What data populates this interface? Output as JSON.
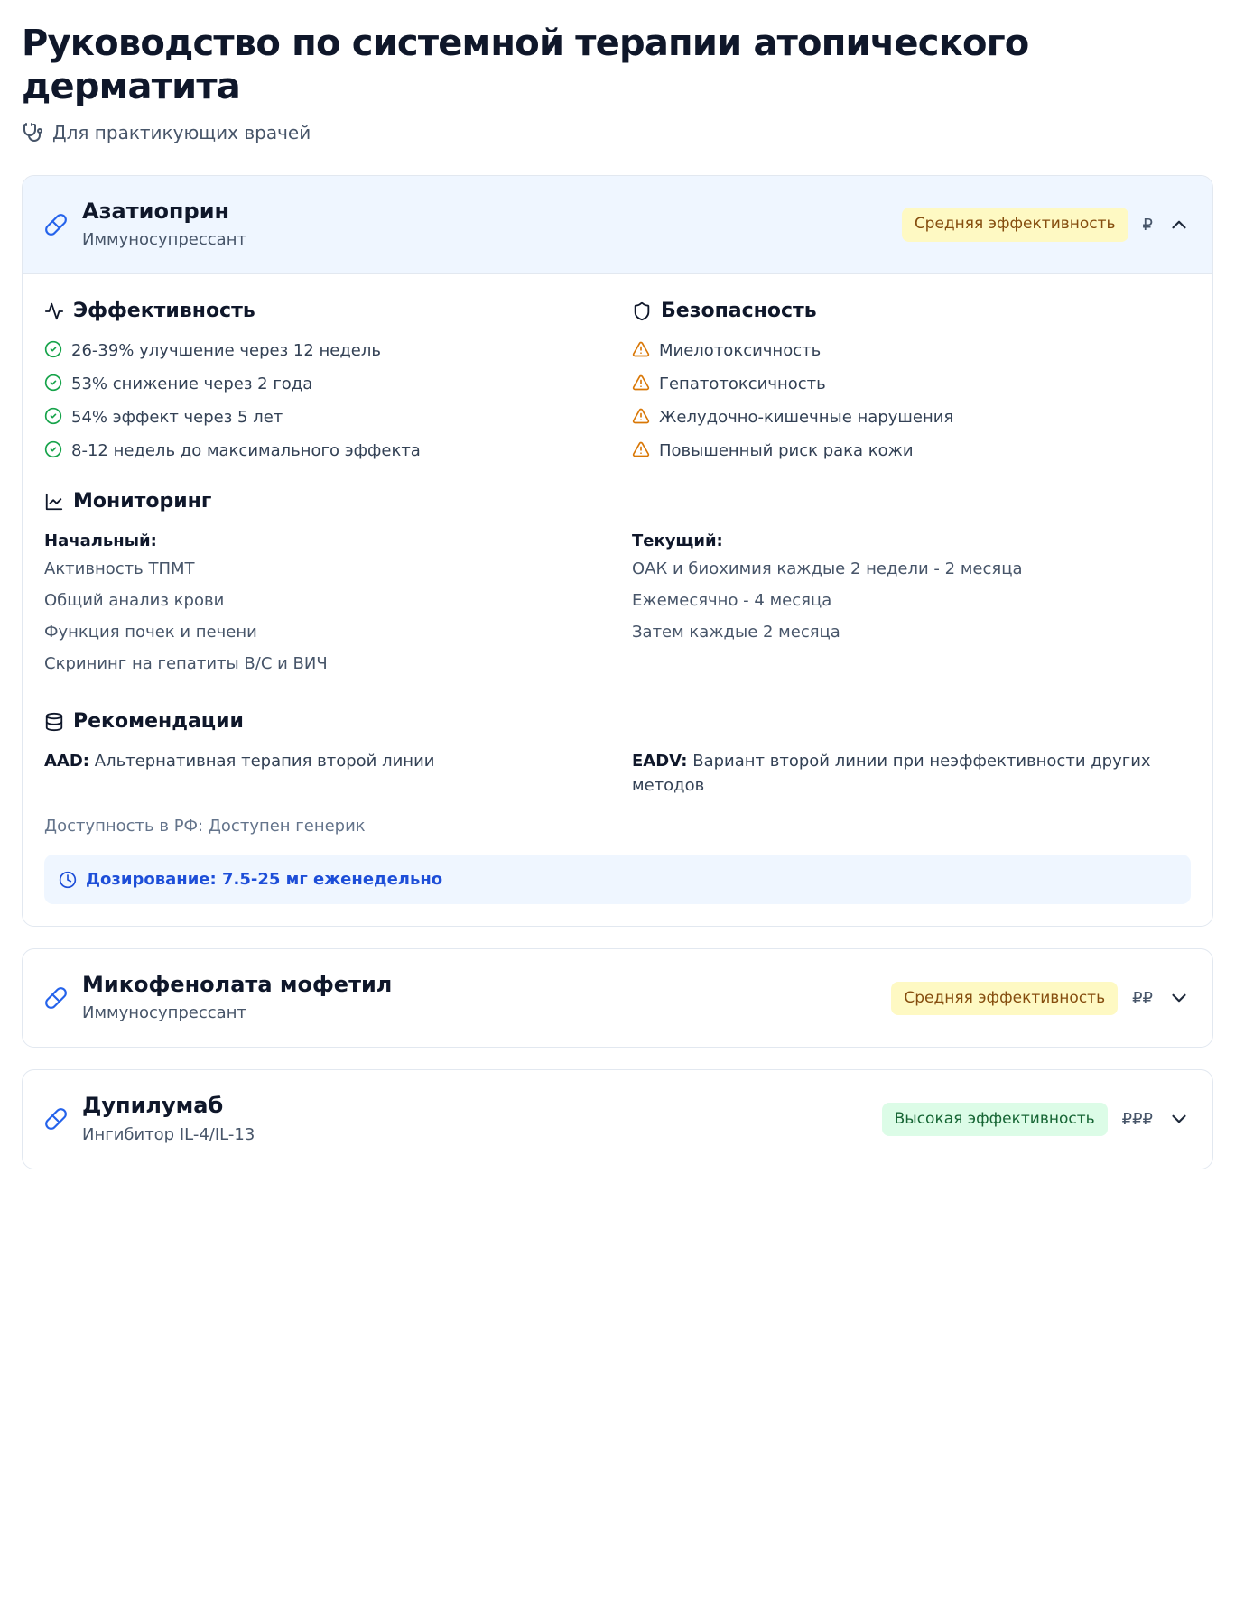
{
  "page": {
    "title": "Руководство по системной терапии атопического дерматита",
    "subtitle": "Для практикующих врачей"
  },
  "labels": {
    "efficacy_h": "Эффективность",
    "safety_h": "Безопасность",
    "monitoring_h": "Мониторинг",
    "recommendations_h": "Рекомендации",
    "mon_initial": "Начальный:",
    "mon_ongoing": "Текущий:",
    "aad": "AAD:",
    "eadv": "EADV:",
    "avail_prefix": "Доступность в РФ:",
    "dosing_prefix": "Дозирование:"
  },
  "drugs": [
    {
      "name": "Азатиоприн",
      "class": "Иммуносупрессант",
      "efficacy_level": "medium",
      "efficacy_badge": "Средняя эффективность",
      "cost_filled": "₽",
      "cost_dim": "",
      "expanded": true,
      "efficacy": [
        "26-39% улучшение через 12 недель",
        "53% снижение через 2 года",
        "54% эффект через 5 лет",
        "8-12 недель до максимального эффекта"
      ],
      "safety": [
        "Миелотоксичность",
        "Гепатотоксичность",
        "Желудочно-кишечные нарушения",
        "Повышенный риск рака кожи"
      ],
      "monitoring": {
        "initial": [
          "Активность ТПМТ",
          "Общий анализ крови",
          "Функция почек и печени",
          "Скрининг на гепатиты B/C и ВИЧ"
        ],
        "ongoing": [
          "ОАК и биохимия каждые 2 недели - 2 месяца",
          "Ежемесячно - 4 месяца",
          "Затем каждые 2 месяца"
        ]
      },
      "recommendations": {
        "aad": "Альтернативная терапия второй линии",
        "eadv": "Вариант второй линии при неэффективности других методов"
      },
      "availability": "Доступен генерик",
      "dosing": "7.5-25 мг еженедельно"
    },
    {
      "name": "Микофенолата мофетил",
      "class": "Иммуносупрессант",
      "efficacy_level": "medium",
      "efficacy_badge": "Средняя эффективность",
      "cost_filled": "₽₽",
      "cost_dim": "",
      "expanded": false
    },
    {
      "name": "Дупилумаб",
      "class": "Ингибитор IL-4/IL-13",
      "efficacy_level": "high",
      "efficacy_badge": "Высокая эффективность",
      "cost_filled": "₽₽₽",
      "cost_dim": "",
      "expanded": false
    }
  ]
}
